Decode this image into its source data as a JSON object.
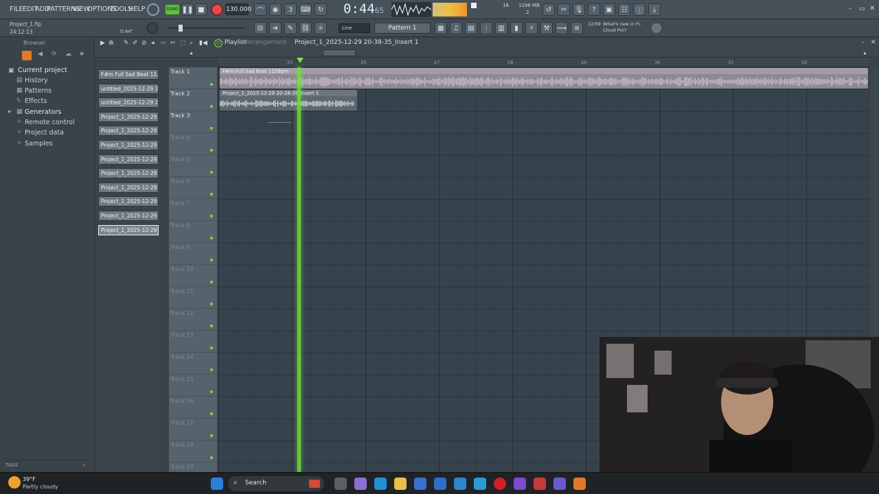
{
  "menubar": {
    "items": [
      "FILE",
      "EDIT",
      "ADD",
      "PATTERNS",
      "VIEW",
      "OPTIONS",
      "TOOLS",
      "HELP"
    ],
    "tempo": "130.000",
    "time": "0:44",
    "time_sub": "65",
    "cpu_mb": "1196 MB",
    "cpu_num": "16",
    "cpu_num2": "2"
  },
  "toolbar2": {
    "project_file": "Project_1.flp",
    "position": "24:12:13",
    "hint_time": "0:44\"",
    "snap": "Line",
    "pattern": "Pattern 1",
    "news_date": "12/09",
    "news_text": "What's new in FL Cloud Pro?"
  },
  "browser": {
    "title": "Browser",
    "items": [
      "Current project",
      "History",
      "Patterns",
      "Effects",
      "Generators",
      "Remote control",
      "Project data",
      "Samples"
    ],
    "tags_label": "TAGS"
  },
  "playlist": {
    "title": "Playlist",
    "arrangement": "Arrangement",
    "breadcrumb": "Project_1_2025-12-29 20-38-35_Insert 1",
    "ruler_ticks": [
      "25",
      "26",
      "27",
      "28",
      "29",
      "30",
      "31",
      "32"
    ]
  },
  "picker": [
    "F#m Full Sad Beat 11...",
    "untitled_2025-12-29 20-...",
    "untitled_2025-12-29 20-...",
    "Project_1_2025-12-29 2...",
    "Project_1_2025-12-29 2...",
    "Project_1_2025-12-29 2...",
    "Project_1_2025-12-29 2...",
    "Project_1_2025-12-29 2...",
    "Project_1_2025-12-29 2...",
    "Project_1_2025-12-29 2...",
    "Project_1_2025-12-29 2...",
    "Project_1_2025-12-29 2..."
  ],
  "tracks": [
    "Track 1",
    "Track 2",
    "Track 3",
    "Track 4",
    "Track 5",
    "Track 6",
    "Track 7",
    "Track 8",
    "Track 9",
    "Track 10",
    "Track 11",
    "Track 12",
    "Track 13",
    "Track 14",
    "Track 15",
    "Track 16",
    "Track 17",
    "Track 18",
    "Track 19"
  ],
  "clips": [
    {
      "label": "F#m Full Sad Beat 115Bpm",
      "color": "#8f8794"
    },
    {
      "label": "Project_1_2025-12-29 20-38-35_Insert 1",
      "color": "#5c6770"
    }
  ],
  "taskbar": {
    "weather_temp": "39°F",
    "weather_desc": "Partly cloudy",
    "search": "Search"
  },
  "colors": {
    "accent_green": "#6ee03a",
    "record": "#e24a4a",
    "clip_purple": "#8f8794"
  }
}
